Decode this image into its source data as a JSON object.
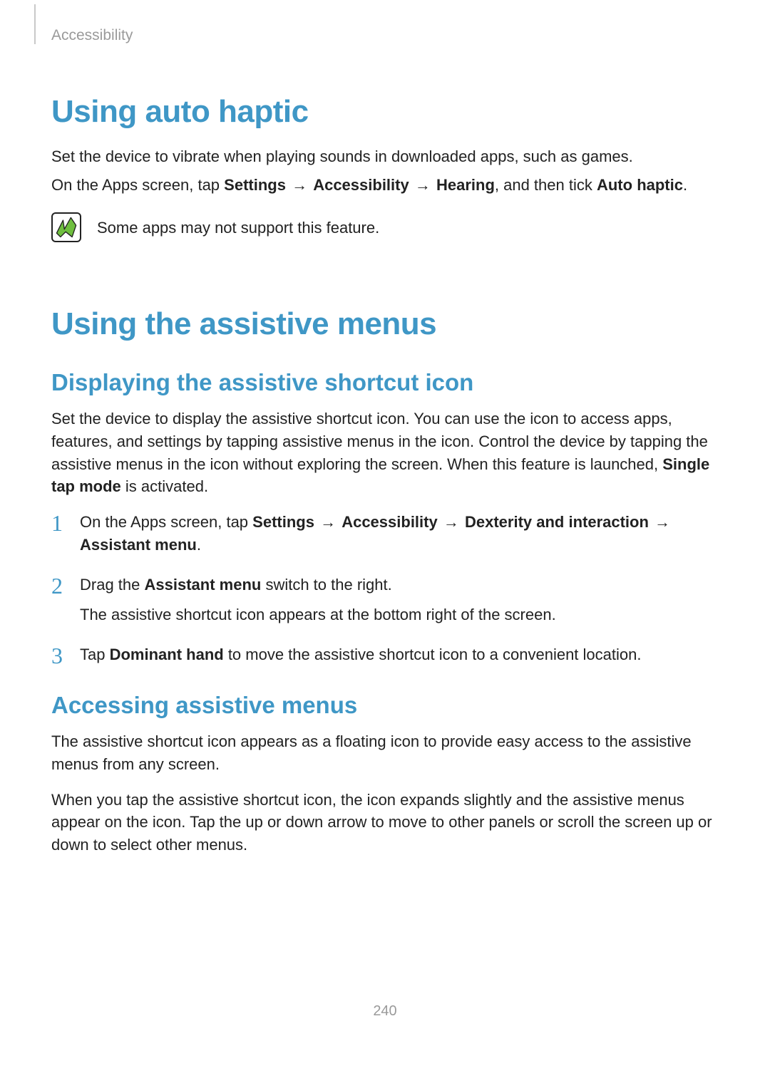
{
  "breadcrumb": "Accessibility",
  "section1": {
    "title": "Using auto haptic",
    "p1": "Set the device to vibrate when playing sounds in downloaded apps, such as games.",
    "p2_pre": "On the Apps screen, tap ",
    "p2_b1": "Settings",
    "arrow": "→",
    "p2_b2": "Accessibility",
    "p2_b3": "Hearing",
    "p2_mid": ", and then tick ",
    "p2_b4": "Auto haptic",
    "p2_end": ".",
    "note": "Some apps may not support this feature."
  },
  "section2": {
    "title": "Using the assistive menus",
    "sub1": {
      "title": "Displaying the assistive shortcut icon",
      "para_pre": "Set the device to display the assistive shortcut icon. You can use the icon to access apps, features, and settings by tapping assistive menus in the icon. Control the device by tapping the assistive menus in the icon without exploring the screen. When this feature is launched, ",
      "para_b": "Single tap mode",
      "para_post": " is activated.",
      "steps": [
        {
          "pre": "On the Apps screen, tap ",
          "b1": "Settings",
          "b2": "Accessibility",
          "b3": "Dexterity and interaction",
          "b4": "Assistant menu",
          "end": "."
        },
        {
          "pre": "Drag the ",
          "b1": "Assistant menu",
          "post": " switch to the right.",
          "sub": "The assistive shortcut icon appears at the bottom right of the screen."
        },
        {
          "pre": "Tap ",
          "b1": "Dominant hand",
          "post": " to move the assistive shortcut icon to a convenient location."
        }
      ]
    },
    "sub2": {
      "title": "Accessing assistive menus",
      "p1": "The assistive shortcut icon appears as a floating icon to provide easy access to the assistive menus from any screen.",
      "p2": "When you tap the assistive shortcut icon, the icon expands slightly and the assistive menus appear on the icon. Tap the up or down arrow to move to other panels or scroll the screen up or down to select other menus."
    }
  },
  "page_number": "240"
}
